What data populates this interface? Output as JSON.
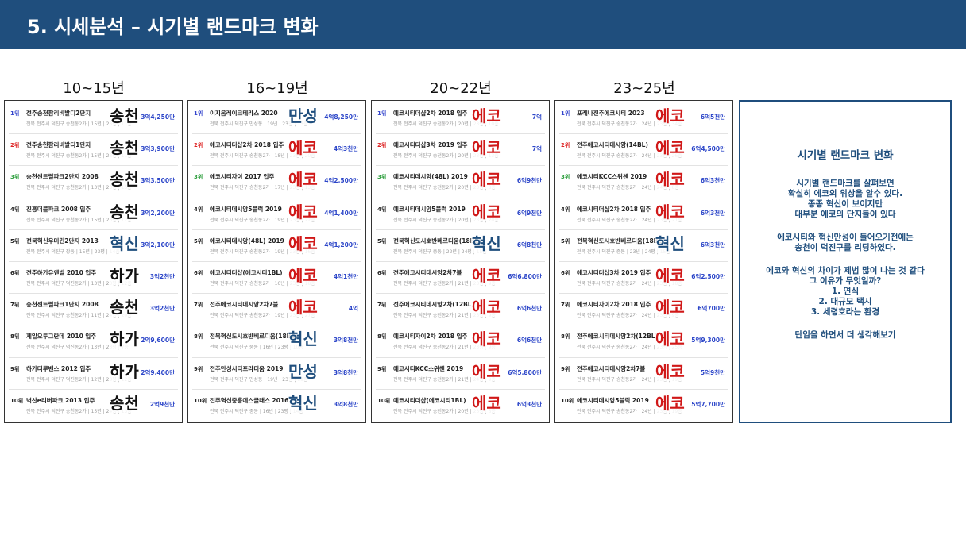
{
  "header": {
    "title": "5. 시세분석 – 시기별 랜드마크 변화"
  },
  "panels": [
    {
      "period": "10~15년",
      "rows": [
        {
          "rank": "1위",
          "rank_color": "blue",
          "apt": "전주송천팜리비발디2단지",
          "sub": "전북 전주시 덕진구 송천동2가 | 15년 | 23평 | 11층",
          "price": "3억4,250만",
          "tag": "송천",
          "tag_color": "black"
        },
        {
          "rank": "2위",
          "rank_color": "red",
          "apt": "전주송천팜리비발디1단지",
          "sub": "전북 전주시 덕진구 송천동2가 | 15년 | 23평 | 11층",
          "price": "3억3,900만",
          "tag": "송천",
          "tag_color": "black"
        },
        {
          "rank": "3위",
          "rank_color": "green",
          "apt": "송천센트럴파크2단지 2008",
          "sub": "전북 전주시 덕진구 송천동2가 | 13년 | 23평 | 15층",
          "price": "3억3,500만",
          "tag": "송천",
          "tag_color": "black"
        },
        {
          "rank": "4위",
          "rank_color": "black",
          "apt": "진흥더블파크 2008 입주",
          "sub": "전북 전주시 덕진구 송천동2가 | 15년 | 23평 | 12층",
          "price": "3억2,200만",
          "tag": "송천",
          "tag_color": "black"
        },
        {
          "rank": "5위",
          "rank_color": "black",
          "apt": "전북혁신우미린2단지 2013",
          "sub": "전북 전주시 덕진구 장동 | 15년 | 23평 | 14층",
          "price": "3억2,100만",
          "tag": "혁신",
          "tag_color": "blue"
        },
        {
          "rank": "6위",
          "rank_color": "black",
          "apt": "전주하가유엔빌 2010 입주",
          "sub": "전북 전주시 덕진구 덕진동2가 | 13년 | 23평 | 12층",
          "price": "3억2천만",
          "tag": "하가",
          "tag_color": "black"
        },
        {
          "rank": "7위",
          "rank_color": "black",
          "apt": "송천센트럴파크1단지 2008",
          "sub": "전북 전주시 덕진구 송천동2가 | 11년 | 24평 | 20층",
          "price": "3억2천만",
          "tag": "송천",
          "tag_color": "black"
        },
        {
          "rank": "8위",
          "rank_color": "black",
          "apt": "제일오투그란데 2010 입주",
          "sub": "전북 전주시 덕진구 덕진동2가 | 13년 | 23평 | 7층",
          "price": "2억9,600만",
          "tag": "하가",
          "tag_color": "black"
        },
        {
          "rank": "9위",
          "rank_color": "black",
          "apt": "하가더루벤스 2012 입주",
          "sub": "전북 전주시 덕진구 덕진동2가 | 12년 | 23평 | 12층",
          "price": "2억9,400만",
          "tag": "하가",
          "tag_color": "black"
        },
        {
          "rank": "10위",
          "rank_color": "black",
          "apt": "벽산e리버파크 2013 입주",
          "sub": "전북 전주시 덕진구 송천동2가 | 15년 | 24평 | 13층",
          "price": "2억9천만",
          "tag": "송천",
          "tag_color": "black"
        }
      ]
    },
    {
      "period": "16~19년",
      "rows": [
        {
          "rank": "1위",
          "rank_color": "blue",
          "apt": "이지움레이크테라스 2020",
          "sub": "전북 전주시 덕진구 만성동 | 19년 | 23평 | 13층",
          "price": "4억8,250만",
          "tag": "만성",
          "tag_color": "blue"
        },
        {
          "rank": "2위",
          "rank_color": "red",
          "apt": "에코시티더샵2차 2018 입주",
          "sub": "전북 전주시 덕진구 송천동2가 | 18년 | 23평 | 20층",
          "price": "4억3천만",
          "tag": "에코",
          "tag_color": "red"
        },
        {
          "rank": "3위",
          "rank_color": "green",
          "apt": "에코시티자이 2017 입주",
          "sub": "전북 전주시 덕진구 송천동2가 | 17년 | 23평 | 13층",
          "price": "4억2,500만",
          "tag": "에코",
          "tag_color": "red"
        },
        {
          "rank": "4위",
          "rank_color": "black",
          "apt": "에코시티데시앙5블럭 2019",
          "sub": "전북 전주시 덕진구 송천동2가 | 19년 | 23평 | 22층",
          "price": "4억1,400만",
          "tag": "에코",
          "tag_color": "red"
        },
        {
          "rank": "5위",
          "rank_color": "black",
          "apt": "에코시티데시앙(48L) 2019",
          "sub": "전북 전주시 덕진구 송천동2가 | 19년 | 23평 | 16층",
          "price": "4억1,200만",
          "tag": "에코",
          "tag_color": "red"
        },
        {
          "rank": "6위",
          "rank_color": "black",
          "apt": "에코시티더샵(에코시티1BL)",
          "sub": "전북 전주시 덕진구 송천동2가 | 16년 | 23평 | 18층",
          "price": "4억1천만",
          "tag": "에코",
          "tag_color": "red"
        },
        {
          "rank": "7위",
          "rank_color": "black",
          "apt": "전주에코시티데시앙2차7블",
          "sub": "전북 전주시 덕진구 송천동2가 | 19년 | 23평 | 27층",
          "price": "4억",
          "tag": "에코",
          "tag_color": "red"
        },
        {
          "rank": "8위",
          "rank_color": "black",
          "apt": "전북혁신도시호반베르디움(18BL)",
          "sub": "전북 전주시 덕진구 중동 | 16년 | 23평 | 10층",
          "price": "3억8천만",
          "tag": "혁신",
          "tag_color": "blue"
        },
        {
          "rank": "9위",
          "rank_color": "black",
          "apt": "전주만성시티프라디움 2019",
          "sub": "전북 전주시 덕진구 만성동 | 19년 | 23평 | 19층",
          "price": "3억8천만",
          "tag": "만성",
          "tag_color": "blue"
        },
        {
          "rank": "10위",
          "rank_color": "black",
          "apt": "전주혁신중흥에스클래스 2016",
          "sub": "전북 전주시 덕진구 중동 | 16년 | 23평 | 14층",
          "price": "3억8천만",
          "tag": "혁신",
          "tag_color": "blue"
        }
      ]
    },
    {
      "period": "20~22년",
      "rows": [
        {
          "rank": "1위",
          "rank_color": "blue",
          "apt": "에코시티더샵2차 2018 입주",
          "sub": "전북 전주시 덕진구 송천동2가 | 20년 | 23평 | 10층",
          "price": "7억",
          "tag": "에코",
          "tag_color": "red"
        },
        {
          "rank": "2위",
          "rank_color": "red",
          "apt": "에코시티더샵3차 2019 입주",
          "sub": "전북 전주시 덕진구 송천동2가 | 20년 | 23평 | 13층",
          "price": "7억",
          "tag": "에코",
          "tag_color": "red"
        },
        {
          "rank": "3위",
          "rank_color": "green",
          "apt": "에코시티데시앙(48L) 2019",
          "sub": "전북 전주시 덕진구 송천동2가 | 20년 | 23평 | 8층",
          "price": "6억9천만",
          "tag": "에코",
          "tag_color": "red"
        },
        {
          "rank": "4위",
          "rank_color": "black",
          "apt": "에코시티데시앙5블럭 2019",
          "sub": "전북 전주시 덕진구 송천동2가 | 20년 | 23평 | 20층",
          "price": "6억9천만",
          "tag": "에코",
          "tag_color": "red"
        },
        {
          "rank": "5위",
          "rank_color": "black",
          "apt": "전북혁신도시호반베르디움(18BL)",
          "sub": "전북 전주시 덕진구 중동 | 22년 | 24평 | 15층",
          "price": "6억8천만",
          "tag": "혁신",
          "tag_color": "blue"
        },
        {
          "rank": "6위",
          "rank_color": "black",
          "apt": "전주에코시티데시앙2차7블",
          "sub": "전북 전주시 덕진구 송천동2가 | 21년 | 23평 | 9층",
          "price": "6억6,800만",
          "tag": "에코",
          "tag_color": "red"
        },
        {
          "rank": "7위",
          "rank_color": "black",
          "apt": "전주에코시티데시앙2차(12BL)",
          "sub": "전북 전주시 덕진구 송천동2가 | 21년 | 23평 | 9층",
          "price": "6억6천만",
          "tag": "에코",
          "tag_color": "red"
        },
        {
          "rank": "8위",
          "rank_color": "black",
          "apt": "에코시티자이2차 2018 입주",
          "sub": "전북 전주시 덕진구 송천동2가 | 21년 | 23평 | 9층",
          "price": "6억6천만",
          "tag": "에코",
          "tag_color": "red"
        },
        {
          "rank": "9위",
          "rank_color": "black",
          "apt": "에코시티KCC스위첸 2019",
          "sub": "전북 전주시 덕진구 송천동2가 | 21년 | 24평 | 9층",
          "price": "6억5,800만",
          "tag": "에코",
          "tag_color": "red"
        },
        {
          "rank": "10위",
          "rank_color": "black",
          "apt": "에코시티더샵(에코시티1BL)",
          "sub": "전북 전주시 덕진구 송천동2가 | 20년 | 23평 | 8층",
          "price": "6억3천만",
          "tag": "에코",
          "tag_color": "red"
        }
      ]
    },
    {
      "period": "23~25년",
      "rows": [
        {
          "rank": "1위",
          "rank_color": "blue",
          "apt": "포레나전주에코시티 2023",
          "sub": "전북 전주시 덕진구 송천동2가 | 24년 | 23평 | 34층",
          "price": "6억5천만",
          "tag": "에코",
          "tag_color": "red"
        },
        {
          "rank": "2위",
          "rank_color": "red",
          "apt": "전주에코시티데시앙(14BL)",
          "sub": "전북 전주시 덕진구 송천동2가 | 24년 | 23평 | 26층",
          "price": "6억4,500만",
          "tag": "에코",
          "tag_color": "red"
        },
        {
          "rank": "3위",
          "rank_color": "green",
          "apt": "에코시티KCC스위첸 2019",
          "sub": "전북 전주시 덕진구 송천동2가 | 24년 | 24평 | 8층",
          "price": "6억3천만",
          "tag": "에코",
          "tag_color": "red"
        },
        {
          "rank": "4위",
          "rank_color": "black",
          "apt": "에코시티더샵2차 2018 입주",
          "sub": "전북 전주시 덕진구 송천동2가 | 24년 | 23평 | 21층",
          "price": "6억3천만",
          "tag": "에코",
          "tag_color": "red"
        },
        {
          "rank": "5위",
          "rank_color": "black",
          "apt": "전북혁신도시호반베르디움(18BL)",
          "sub": "전북 전주시 덕진구 중동 | 23년 | 24평 | 15층",
          "price": "6억3천만",
          "tag": "혁신",
          "tag_color": "blue"
        },
        {
          "rank": "6위",
          "rank_color": "black",
          "apt": "에코시티더샵3차 2019 입주",
          "sub": "전북 전주시 덕진구 송천동2가 | 24년 | 23평 | 18층",
          "price": "6억2,500만",
          "tag": "에코",
          "tag_color": "red"
        },
        {
          "rank": "7위",
          "rank_color": "black",
          "apt": "에코시티자이2차 2018 입주",
          "sub": "전북 전주시 덕진구 송천동2가 | 24년 | 23평 | 9층",
          "price": "6억700만",
          "tag": "에코",
          "tag_color": "red"
        },
        {
          "rank": "8위",
          "rank_color": "black",
          "apt": "전주에코시티데시앙2차(12BL)",
          "sub": "전북 전주시 덕진구 송천동2가 | 24년 | 23평 | 25층",
          "price": "5억9,300만",
          "tag": "에코",
          "tag_color": "red"
        },
        {
          "rank": "9위",
          "rank_color": "black",
          "apt": "전주에코시티데시앙2차7블",
          "sub": "전북 전주시 덕진구 송천동2가 | 24년 | 23평 | 19층",
          "price": "5억9천만",
          "tag": "에코",
          "tag_color": "red"
        },
        {
          "rank": "10위",
          "rank_color": "black",
          "apt": "에코시티데시앙5블럭 2019",
          "sub": "전북 전주시 덕진구 송천동2가 | 24년 | 23평 | 19층",
          "price": "5억7,700만",
          "tag": "에코",
          "tag_color": "red"
        }
      ]
    }
  ],
  "note": {
    "title": "시기별 랜드마크 변화",
    "p1": [
      "시기별 랜드마크를 살펴보면",
      "확실히 에코의 위상을 알수 있다.",
      "종종 혁신이 보이지만",
      "대부분 에코의 단지들이 있다"
    ],
    "p2": [
      "에코시티와 혁신만성이 들어오기전에는",
      "송천이 덕진구를 리딩하였다."
    ],
    "p3": [
      "에코와 혁신의 차이가 제법 많이 나는 것 같다",
      "그 이유가 무엇일까?",
      "1.   연식",
      "2.   대규모 택시",
      "3.   세령호라는 환경"
    ],
    "p4": [
      "단임을 하면서 더 생각해보기"
    ]
  },
  "colors": {
    "header_bg": "#1f4e7d",
    "tag_red": "#d01818",
    "tag_blue": "#1f4e7d",
    "price": "#2b45c8"
  }
}
